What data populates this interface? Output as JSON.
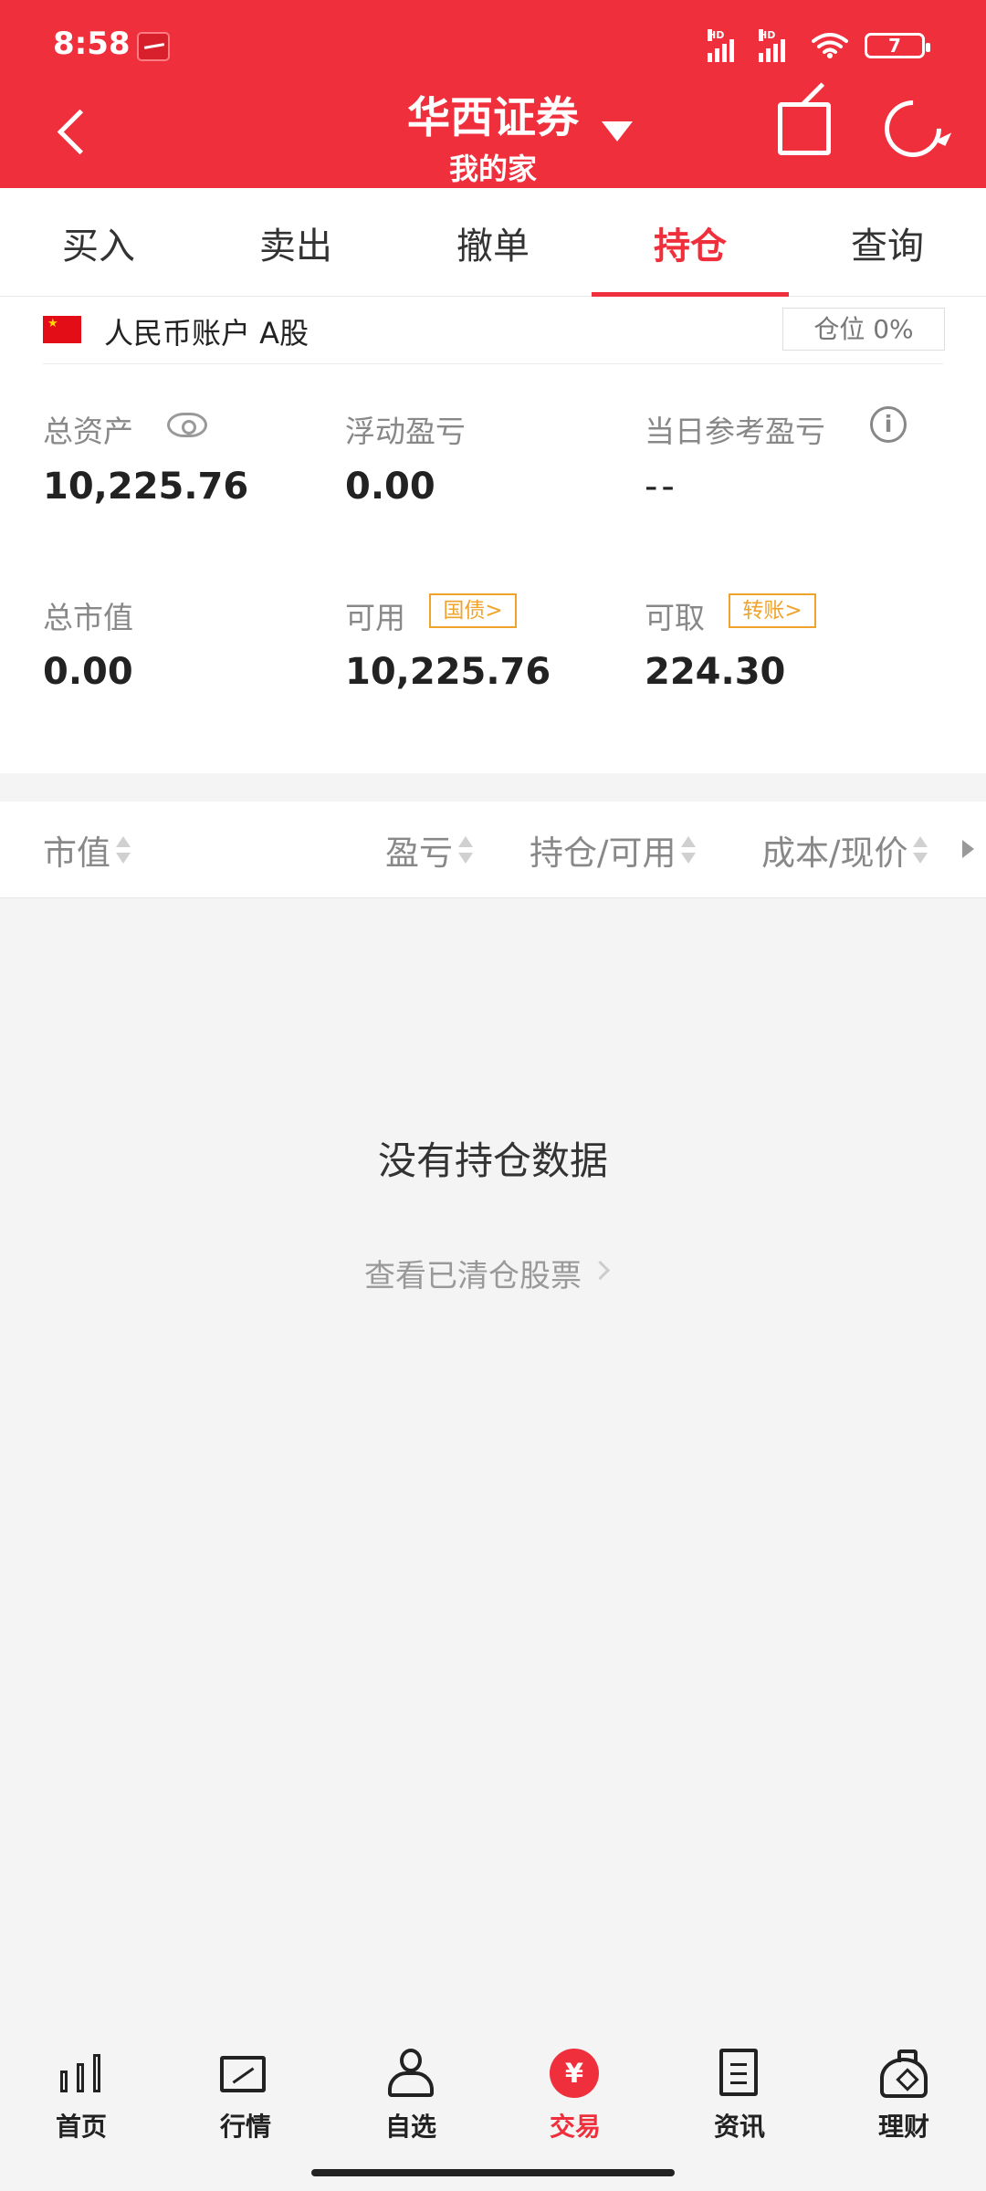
{
  "status_bar": {
    "time": "8:58",
    "signal_1": "HD",
    "signal_2": "HD",
    "battery": "7"
  },
  "header": {
    "brand": "华西证券",
    "account_name": "我的家",
    "back_icon": "back-icon",
    "share_icon": "share-icon",
    "refresh_icon": "refresh-icon"
  },
  "tabs": [
    {
      "label": "买入",
      "active": false
    },
    {
      "label": "卖出",
      "active": false
    },
    {
      "label": "撤单",
      "active": false
    },
    {
      "label": "持仓",
      "active": true
    },
    {
      "label": "查询",
      "active": false
    }
  ],
  "account": {
    "label": "人民币账户 A股",
    "position": "仓位 0%",
    "metrics": [
      {
        "label": "总资产",
        "value": "10,225.76"
      },
      {
        "label": "浮动盈亏",
        "value": "0.00"
      },
      {
        "label": "当日参考盈亏",
        "value": "--"
      },
      {
        "label": "总市值",
        "value": "0.00"
      },
      {
        "label": "可用",
        "value": "10,225.76",
        "tag": "国债>"
      },
      {
        "label": "可取",
        "value": "224.30",
        "tag": "转账>"
      }
    ]
  },
  "holdings_table": {
    "headers": [
      "市值",
      "盈亏",
      "持仓/可用",
      "成本/现价"
    ]
  },
  "empty_state": {
    "title": "没有持仓数据",
    "link": "查看已清仓股票"
  },
  "bottom_nav": [
    {
      "label": "首页",
      "icon": "candlestick-icon",
      "active": false
    },
    {
      "label": "行情",
      "icon": "market-chart-icon",
      "active": false
    },
    {
      "label": "自选",
      "icon": "person-icon",
      "active": false
    },
    {
      "label": "交易",
      "icon": "yuan-icon",
      "active": true
    },
    {
      "label": "资讯",
      "icon": "document-icon",
      "active": false
    },
    {
      "label": "理财",
      "icon": "money-bag-icon",
      "active": false
    }
  ],
  "colors": {
    "brand_red": "#f02f3d",
    "tag_orange": "#f0a32b",
    "background": "#f4f4f4"
  }
}
